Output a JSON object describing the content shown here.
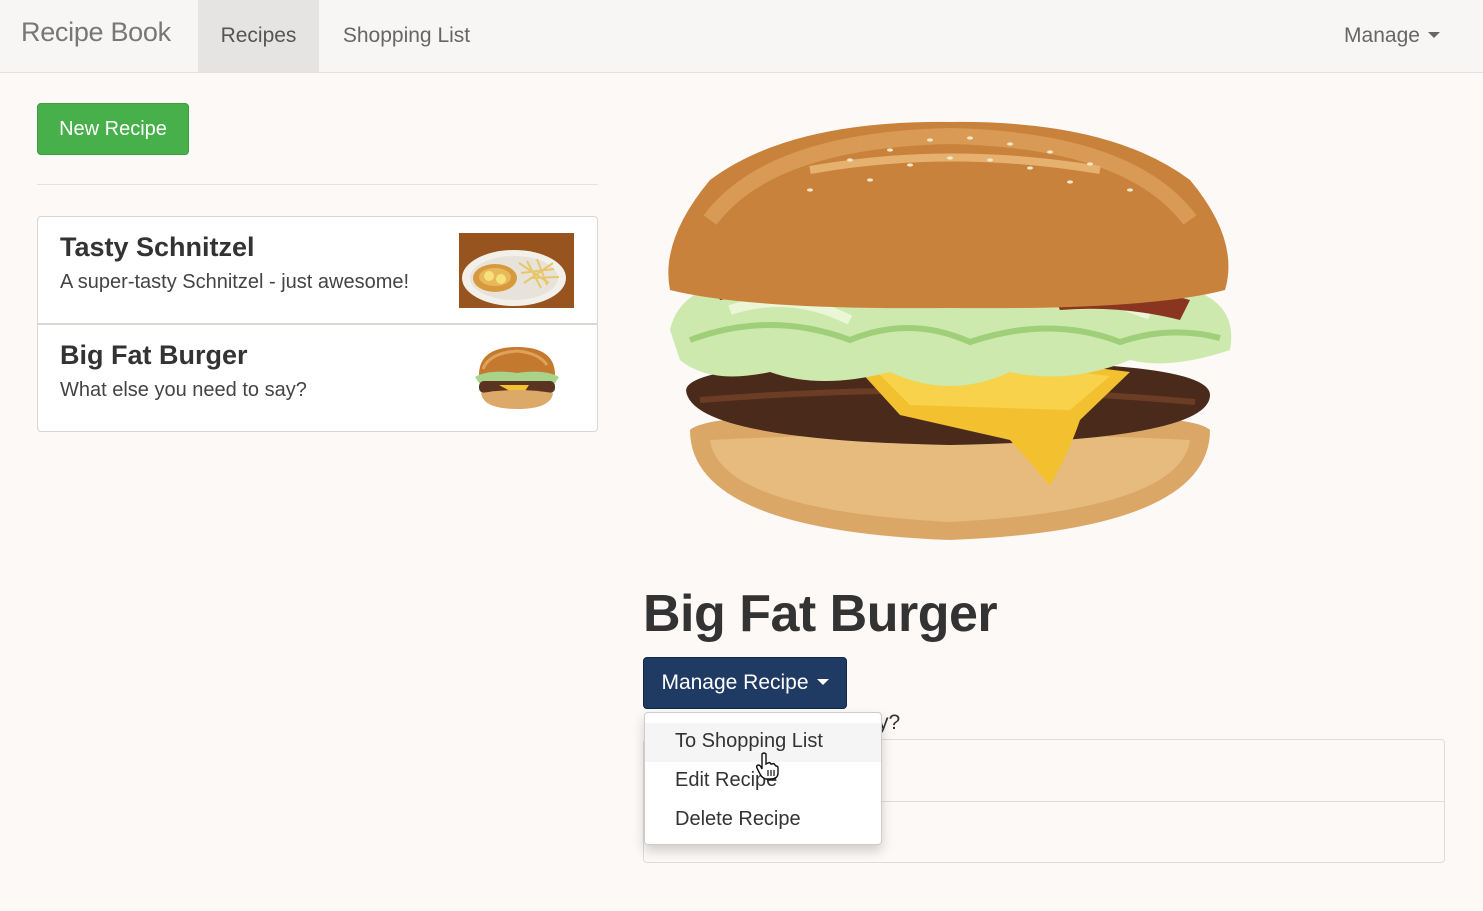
{
  "navbar": {
    "brand": "Recipe Book",
    "items": [
      {
        "label": "Recipes",
        "active": true
      },
      {
        "label": "Shopping List",
        "active": false
      }
    ],
    "manage_label": "Manage"
  },
  "sidebar": {
    "new_button": "New Recipe",
    "recipes": [
      {
        "name": "Tasty Schnitzel",
        "description": "A super-tasty Schnitzel - just awesome!"
      },
      {
        "name": "Big Fat Burger",
        "description": "What else you need to say?"
      }
    ]
  },
  "detail": {
    "title": "Big Fat Burger",
    "manage_button": "Manage Recipe",
    "description_visible_fragment": "y?",
    "dropdown": [
      {
        "label": "To Shopping List"
      },
      {
        "label": "Edit Recipe"
      },
      {
        "label": "Delete Recipe"
      }
    ]
  },
  "colors": {
    "success_button": "#47b04b",
    "primary_button": "#1f3a63",
    "page_background": "#fdf9f7"
  }
}
